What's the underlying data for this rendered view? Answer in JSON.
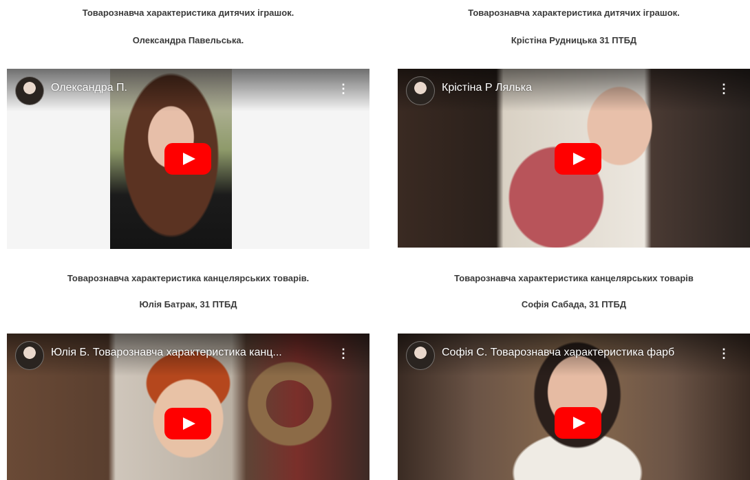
{
  "cards": [
    {
      "caption_title": "Товарознавча характеристика дитячих іграшок.",
      "caption_author": "Олександра Павельська.",
      "video_title": "Олександра П."
    },
    {
      "caption_title": "Товарознавча характеристика дитячих іграшок.",
      "caption_author": "Крістіна Рудницька 31 ПТБД",
      "video_title": "Крістіна Р Лялька"
    },
    {
      "caption_title": "Товарознавча характеристика канцелярських товарів.",
      "caption_author": "Юлія Батрак, 31 ПТБД",
      "video_title": "Юлія Б. Товарознавча характеристика канц..."
    },
    {
      "caption_title": "Товарознавча характеристика канцелярських товарів",
      "caption_author": "Софія Сабада, 31 ПТБД",
      "video_title": "Софія С. Товарознавча характеристика фарб"
    }
  ],
  "icons": {
    "menu": "more-vert-icon",
    "play": "youtube-play-icon",
    "channel": "channel-avatar"
  },
  "colors": {
    "caption_text": "#3a3a3a",
    "play_button": "#ff0000"
  }
}
